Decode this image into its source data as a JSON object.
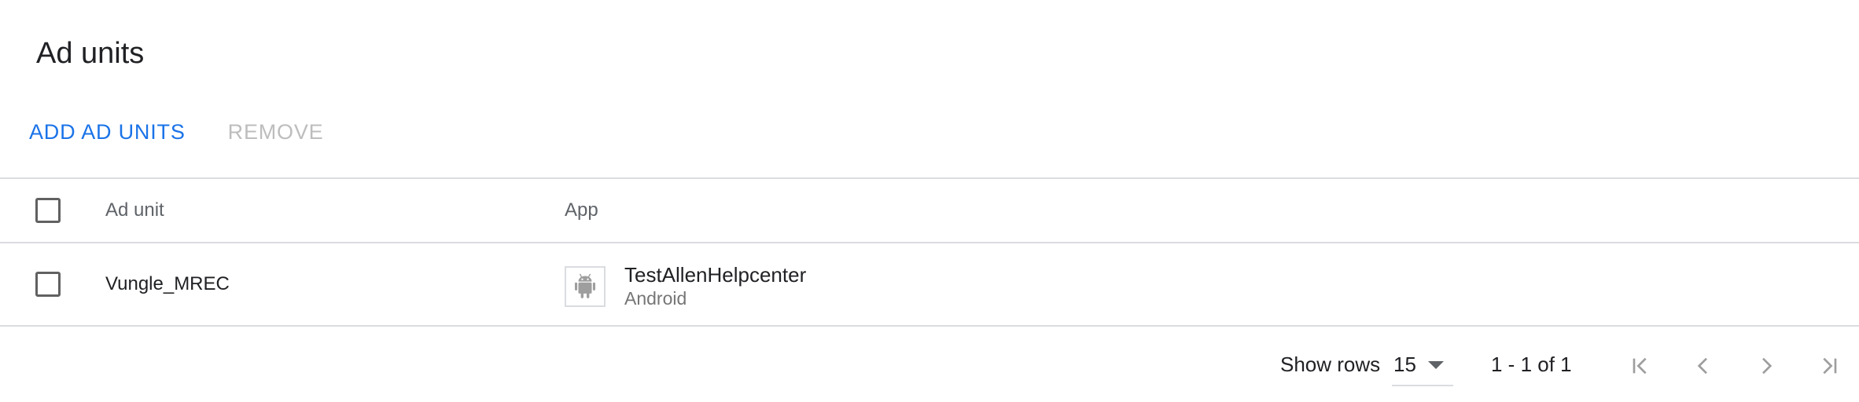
{
  "page": {
    "title": "Ad units"
  },
  "actions": {
    "add_label": "ADD AD UNITS",
    "remove_label": "REMOVE"
  },
  "table": {
    "columns": [
      "Ad unit",
      "App"
    ],
    "rows": [
      {
        "ad_unit": "Vungle_MREC",
        "app_name": "TestAllenHelpcenter",
        "app_platform": "Android",
        "app_icon": "android-icon"
      }
    ]
  },
  "pagination": {
    "show_rows_label": "Show rows",
    "rows_per_page": "15",
    "range": "1 - 1 of 1",
    "icons": [
      "first-page-icon",
      "previous-page-icon",
      "next-page-icon",
      "last-page-icon"
    ]
  },
  "colors": {
    "accent": "#1a73e8",
    "disabled": "#bdbdbd",
    "divider": "#dadce0",
    "icon_gray": "#9e9e9e"
  }
}
